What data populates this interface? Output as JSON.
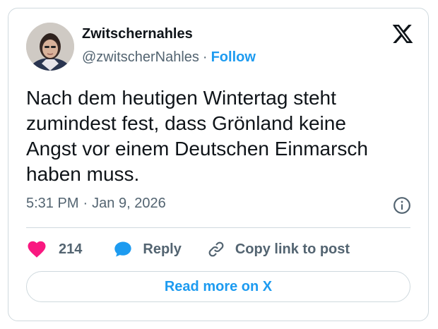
{
  "author": {
    "display_name": "Zwitschernahles",
    "handle": "@zwitscherNahles",
    "separator": "·",
    "follow_label": "Follow",
    "avatar_icon": "profile-photo"
  },
  "logo_icon": "x-logo-icon",
  "tweet": {
    "text": "Nach dem heutigen Wintertag steht\nzumindest fest, dass Grönland keine\nAngst vor einem Deutschen Einmarsch\nhaben muss.",
    "time": "5:31 PM",
    "separator": "·",
    "date": "Jan 9, 2026"
  },
  "actions": {
    "like_count": "214",
    "reply_label": "Reply",
    "copy_link_label": "Copy link to post"
  },
  "read_more_label": "Read more on X",
  "colors": {
    "accent": "#1d9bf0",
    "like": "#f91880",
    "text": "#0f1419",
    "secondary": "#536471",
    "border": "#cfd9de"
  }
}
